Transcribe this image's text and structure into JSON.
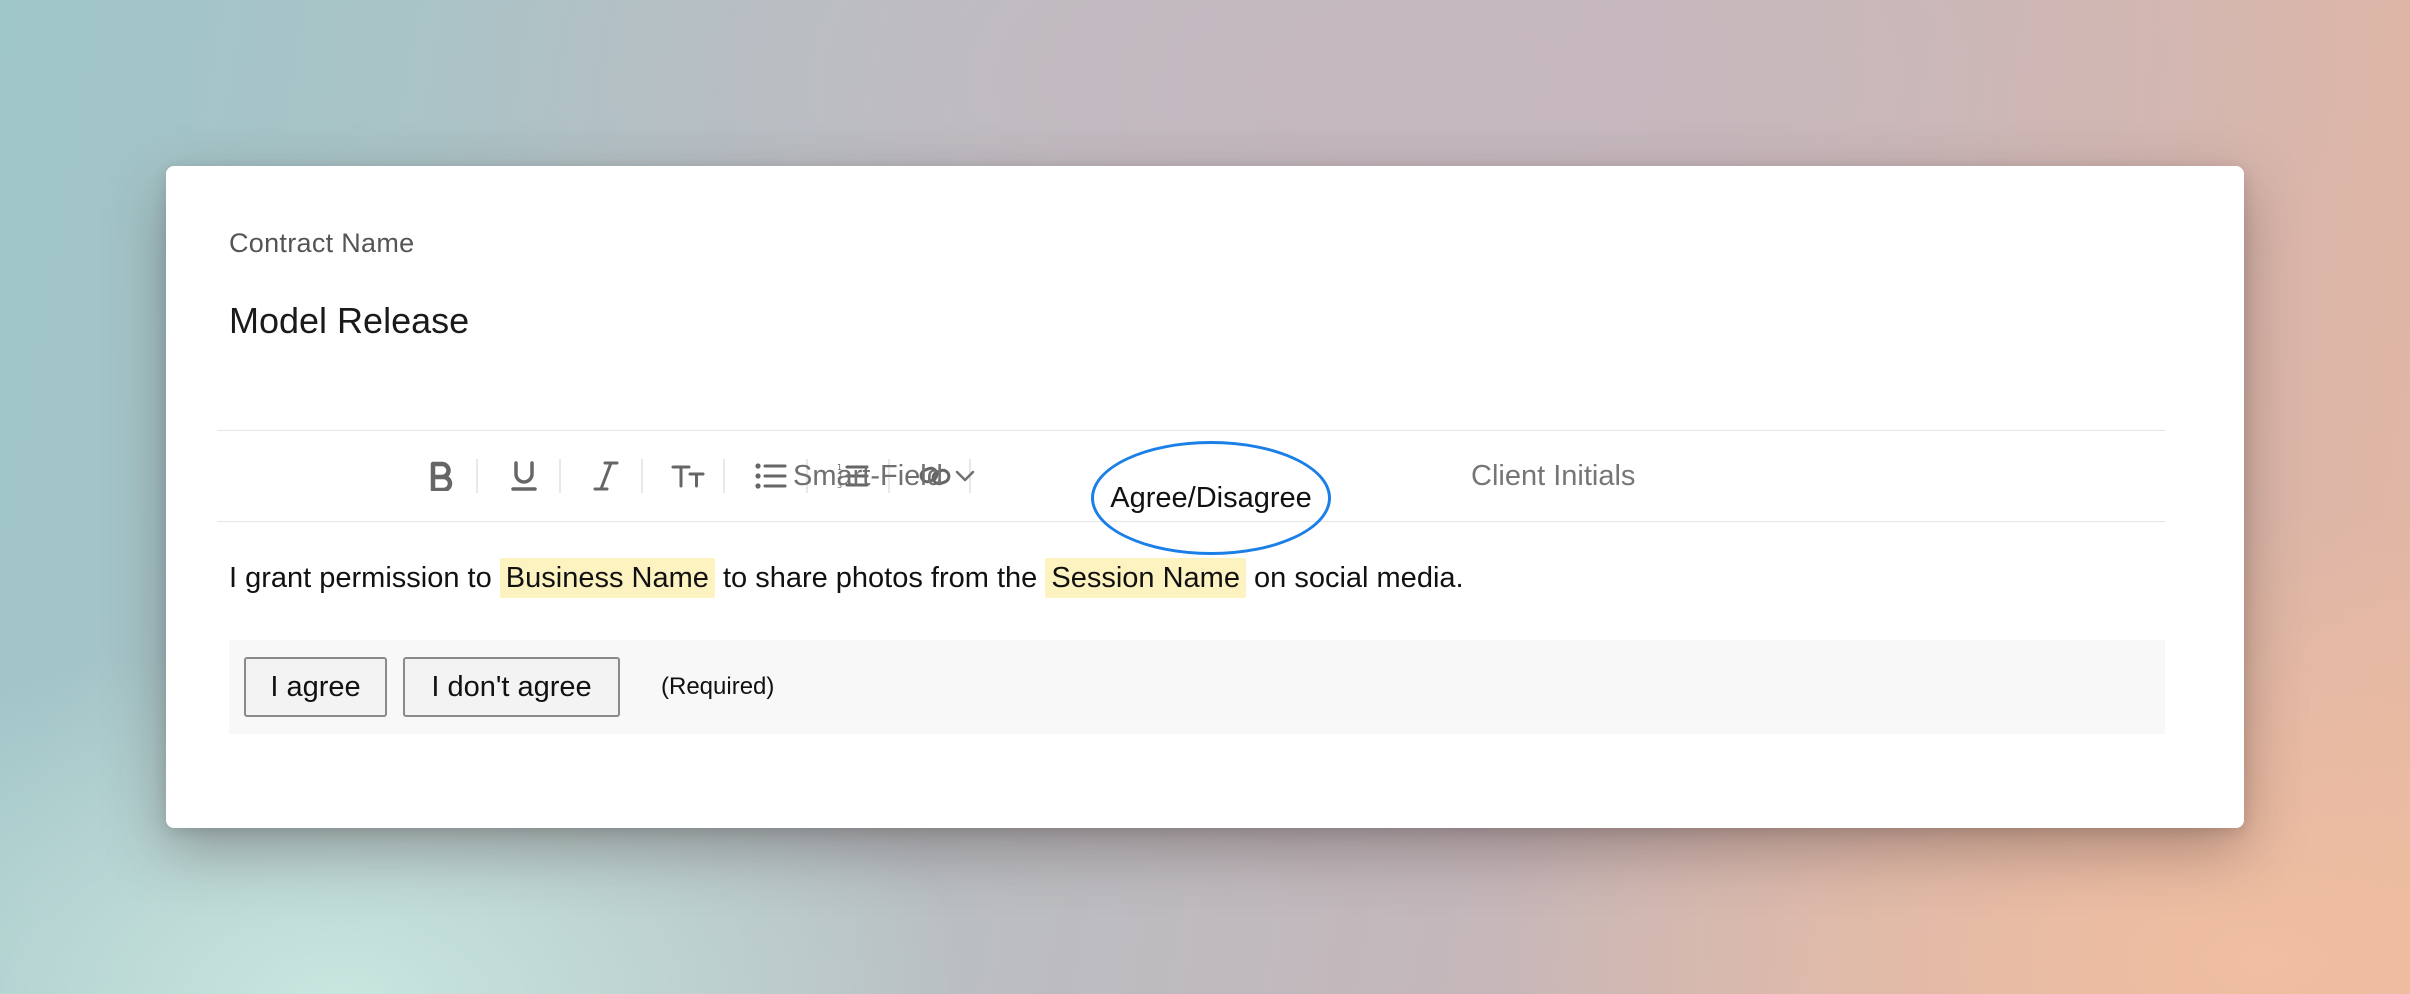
{
  "contract": {
    "label": "Contract Name",
    "title": "Model Release"
  },
  "toolbar": {
    "buttons": [
      "bold-icon",
      "underline-icon",
      "italic-icon",
      "text-size-icon",
      "bullet-list-icon",
      "numbered-list-icon",
      "link-icon"
    ],
    "smart_field_label": "Smart-Field",
    "agree_disagree_label": "Agree/Disagree",
    "client_initials_label": "Client Initials"
  },
  "content": {
    "text_1": "I grant permission to",
    "field_1": "Business Name",
    "text_2": "to share photos from the",
    "field_2": "Session Name",
    "text_3": "on social media."
  },
  "choices": {
    "agree_label": "I agree",
    "disagree_label": "I don't agree",
    "required_note": "(Required)"
  },
  "annotation": {
    "color": "#1a7fe6",
    "target": "Agree/Disagree"
  },
  "colors": {
    "highlight": "#fdf3c1"
  }
}
